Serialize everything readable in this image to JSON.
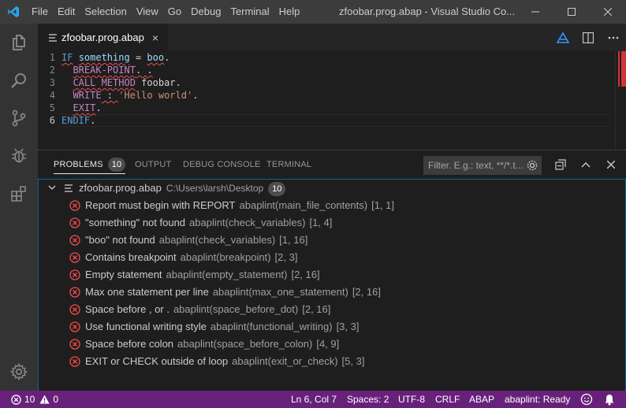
{
  "window": {
    "title": "zfoobar.prog.abap - Visual Studio Co..."
  },
  "menu": [
    "File",
    "Edit",
    "Selection",
    "View",
    "Go",
    "Debug",
    "Terminal",
    "Help"
  ],
  "editor": {
    "tab_label": "zfoobar.prog.abap",
    "tab_close": "×",
    "line_numbers": [
      "1",
      "2",
      "3",
      "4",
      "5",
      "6"
    ],
    "code": {
      "l1_kw": "IF",
      "l1_id": "something",
      "l1_op": " = ",
      "l1_id2": "boo",
      "l1_end": ".",
      "l2_kw": "BREAK-POINT",
      "l2_end": ". .",
      "l3_kw": "CALL METHOD",
      "l3_id": "foobar",
      "l3_end": ".",
      "l4_kw": "WRITE",
      "l4_mid": " : ",
      "l4_str": "'Hello world'",
      "l4_end": ".",
      "l5_kw": "EXIT",
      "l5_end": ".",
      "l6_kw": "ENDIF",
      "l6_end": "."
    }
  },
  "panel": {
    "tabs": {
      "problems": "PROBLEMS",
      "problems_count": "10",
      "output": "OUTPUT",
      "debug_console": "DEBUG CONSOLE",
      "terminal": "TERMINAL"
    },
    "filter_placeholder": "Filter. E.g.: text, **/*.t...",
    "file_group": {
      "name": "zfoobar.prog.abap",
      "path": "C:\\Users\\larsh\\Desktop",
      "count": "10"
    },
    "problems": [
      {
        "message": "Report must begin with REPORT",
        "source": "abaplint(main_file_contents)",
        "pos": "[1, 1]"
      },
      {
        "message": "\"something\" not found",
        "source": "abaplint(check_variables)",
        "pos": "[1, 4]"
      },
      {
        "message": "\"boo\" not found",
        "source": "abaplint(check_variables)",
        "pos": "[1, 16]"
      },
      {
        "message": "Contains breakpoint",
        "source": "abaplint(breakpoint)",
        "pos": "[2, 3]"
      },
      {
        "message": "Empty statement",
        "source": "abaplint(empty_statement)",
        "pos": "[2, 16]"
      },
      {
        "message": "Max one statement per line",
        "source": "abaplint(max_one_statement)",
        "pos": "[2, 16]"
      },
      {
        "message": "Space before , or .",
        "source": "abaplint(space_before_dot)",
        "pos": "[2, 16]"
      },
      {
        "message": "Use functional writing style",
        "source": "abaplint(functional_writing)",
        "pos": "[3, 3]"
      },
      {
        "message": "Space before colon",
        "source": "abaplint(space_before_colon)",
        "pos": "[4, 9]"
      },
      {
        "message": "EXIT or CHECK outside of loop",
        "source": "abaplint(exit_or_check)",
        "pos": "[5, 3]"
      }
    ]
  },
  "statusbar": {
    "errors": "10",
    "warnings": "0",
    "cursor": "Ln 6, Col 7",
    "spaces": "Spaces: 2",
    "encoding": "UTF-8",
    "eol": "CRLF",
    "language": "ABAP",
    "linter": "abaplint: Ready"
  },
  "colors": {
    "statusbar": "#68217a",
    "error": "#f14c4c",
    "focus_border": "#0e639c"
  }
}
